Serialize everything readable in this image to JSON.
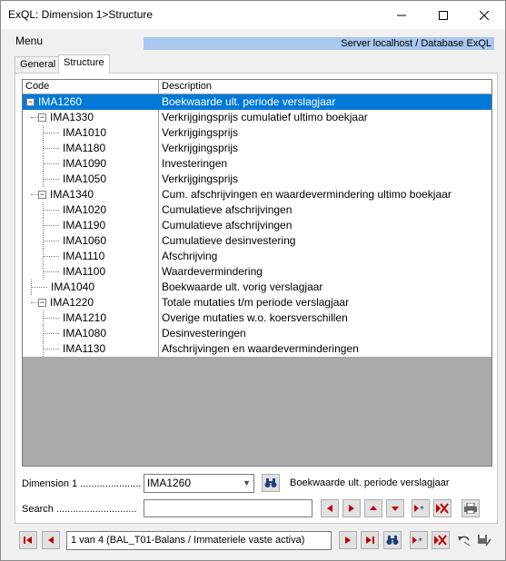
{
  "window": {
    "title": "ExQL: Dimension 1>Structure"
  },
  "menu": {
    "label": "Menu"
  },
  "server_info": "Server localhost / Database ExQL",
  "tabs": [
    {
      "label": "General",
      "active": false
    },
    {
      "label": "Structure",
      "active": true
    }
  ],
  "grid": {
    "columns": [
      "Code",
      "Description"
    ],
    "rows": [
      {
        "code": "IMA1260",
        "desc": "Boekwaarde ult. periode verslagjaar",
        "level": 0,
        "expandable": true,
        "selected": true
      },
      {
        "code": "IMA1330",
        "desc": "Verkrijgingsprijs cumulatief ultimo boekjaar",
        "level": 1,
        "expandable": true
      },
      {
        "code": "IMA1010",
        "desc": "Verkrijgingsprijs",
        "level": 2
      },
      {
        "code": "IMA1180",
        "desc": "Verkrijgingsprijs",
        "level": 2
      },
      {
        "code": "IMA1090",
        "desc": "Investeringen",
        "level": 2
      },
      {
        "code": "IMA1050",
        "desc": "Verkrijgingsprijs",
        "level": 2
      },
      {
        "code": "IMA1340",
        "desc": "Cum. afschrijvingen en waardevermindering ultimo boekjaar",
        "level": 1,
        "expandable": true
      },
      {
        "code": "IMA1020",
        "desc": "Cumulatieve afschrijvingen",
        "level": 2
      },
      {
        "code": "IMA1190",
        "desc": "Cumulatieve afschrijvingen",
        "level": 2
      },
      {
        "code": "IMA1060",
        "desc": "Cumulatieve desinvestering",
        "level": 2
      },
      {
        "code": "IMA1110",
        "desc": "Afschrijving",
        "level": 2
      },
      {
        "code": "IMA1100",
        "desc": "Waardevermindering",
        "level": 2
      },
      {
        "code": "IMA1040",
        "desc": "Boekwaarde ult. vorig verslagjaar",
        "level": 1
      },
      {
        "code": "IMA1220",
        "desc": "Totale mutaties t/m periode verslagjaar",
        "level": 1,
        "expandable": true
      },
      {
        "code": "IMA1210",
        "desc": "Overige mutaties w.o. koersverschillen",
        "level": 2
      },
      {
        "code": "IMA1080",
        "desc": "Desinvesteringen",
        "level": 2
      },
      {
        "code": "IMA1130",
        "desc": "Afschrijvingen en waardeverminderingen",
        "level": 2
      }
    ]
  },
  "dimension": {
    "label": "Dimension 1 ......................",
    "value": "IMA1260",
    "description": "Boekwaarde ult. periode verslagjaar"
  },
  "search": {
    "label": "Search .............................",
    "value": ""
  },
  "navigator": {
    "record_text": "1 van 4 (BAL_T01-Balans / Immateriele vaste activa)"
  }
}
